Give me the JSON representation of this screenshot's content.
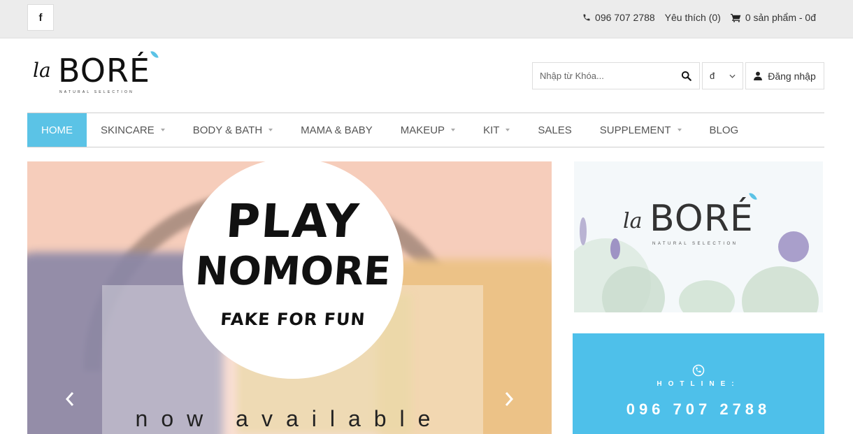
{
  "topbar": {
    "facebook_icon": "facebook-icon",
    "phone": "096 707 2788",
    "favorites": "Yêu thích (0)",
    "cart": "0 sản phẩm - 0đ"
  },
  "header": {
    "logo": {
      "la": "la",
      "brand": "BORÉ",
      "tagline": "NATURAL SELECTION"
    },
    "search": {
      "placeholder": "Nhập từ Khóa...",
      "value": ""
    },
    "currency": "đ",
    "login": "Đăng nhập"
  },
  "nav": {
    "items": [
      {
        "label": "HOME",
        "active": true,
        "dropdown": false
      },
      {
        "label": "SKINCARE",
        "active": false,
        "dropdown": true
      },
      {
        "label": "BODY & BATH",
        "active": false,
        "dropdown": true
      },
      {
        "label": "MAMA & BABY",
        "active": false,
        "dropdown": false
      },
      {
        "label": "MAKEUP",
        "active": false,
        "dropdown": true
      },
      {
        "label": "KIT",
        "active": false,
        "dropdown": true
      },
      {
        "label": "SALES",
        "active": false,
        "dropdown": false
      },
      {
        "label": "SUPPLEMENT",
        "active": false,
        "dropdown": true
      },
      {
        "label": "BLOG",
        "active": false,
        "dropdown": false
      }
    ]
  },
  "banner": {
    "line1": "PLAY",
    "line2": "NOMORE",
    "line3": "FAKE FOR FUN",
    "caption": "now available"
  },
  "side_banner": {
    "la": "la",
    "brand": "BORÉ",
    "tagline": "NATURAL SELECTION"
  },
  "hotline": {
    "label": "HOTLINE:",
    "number": "096 707 2788"
  },
  "colors": {
    "accent": "#5bc3e6",
    "hotline_bg": "#4ec0ea",
    "topbar_bg": "#ececec"
  }
}
